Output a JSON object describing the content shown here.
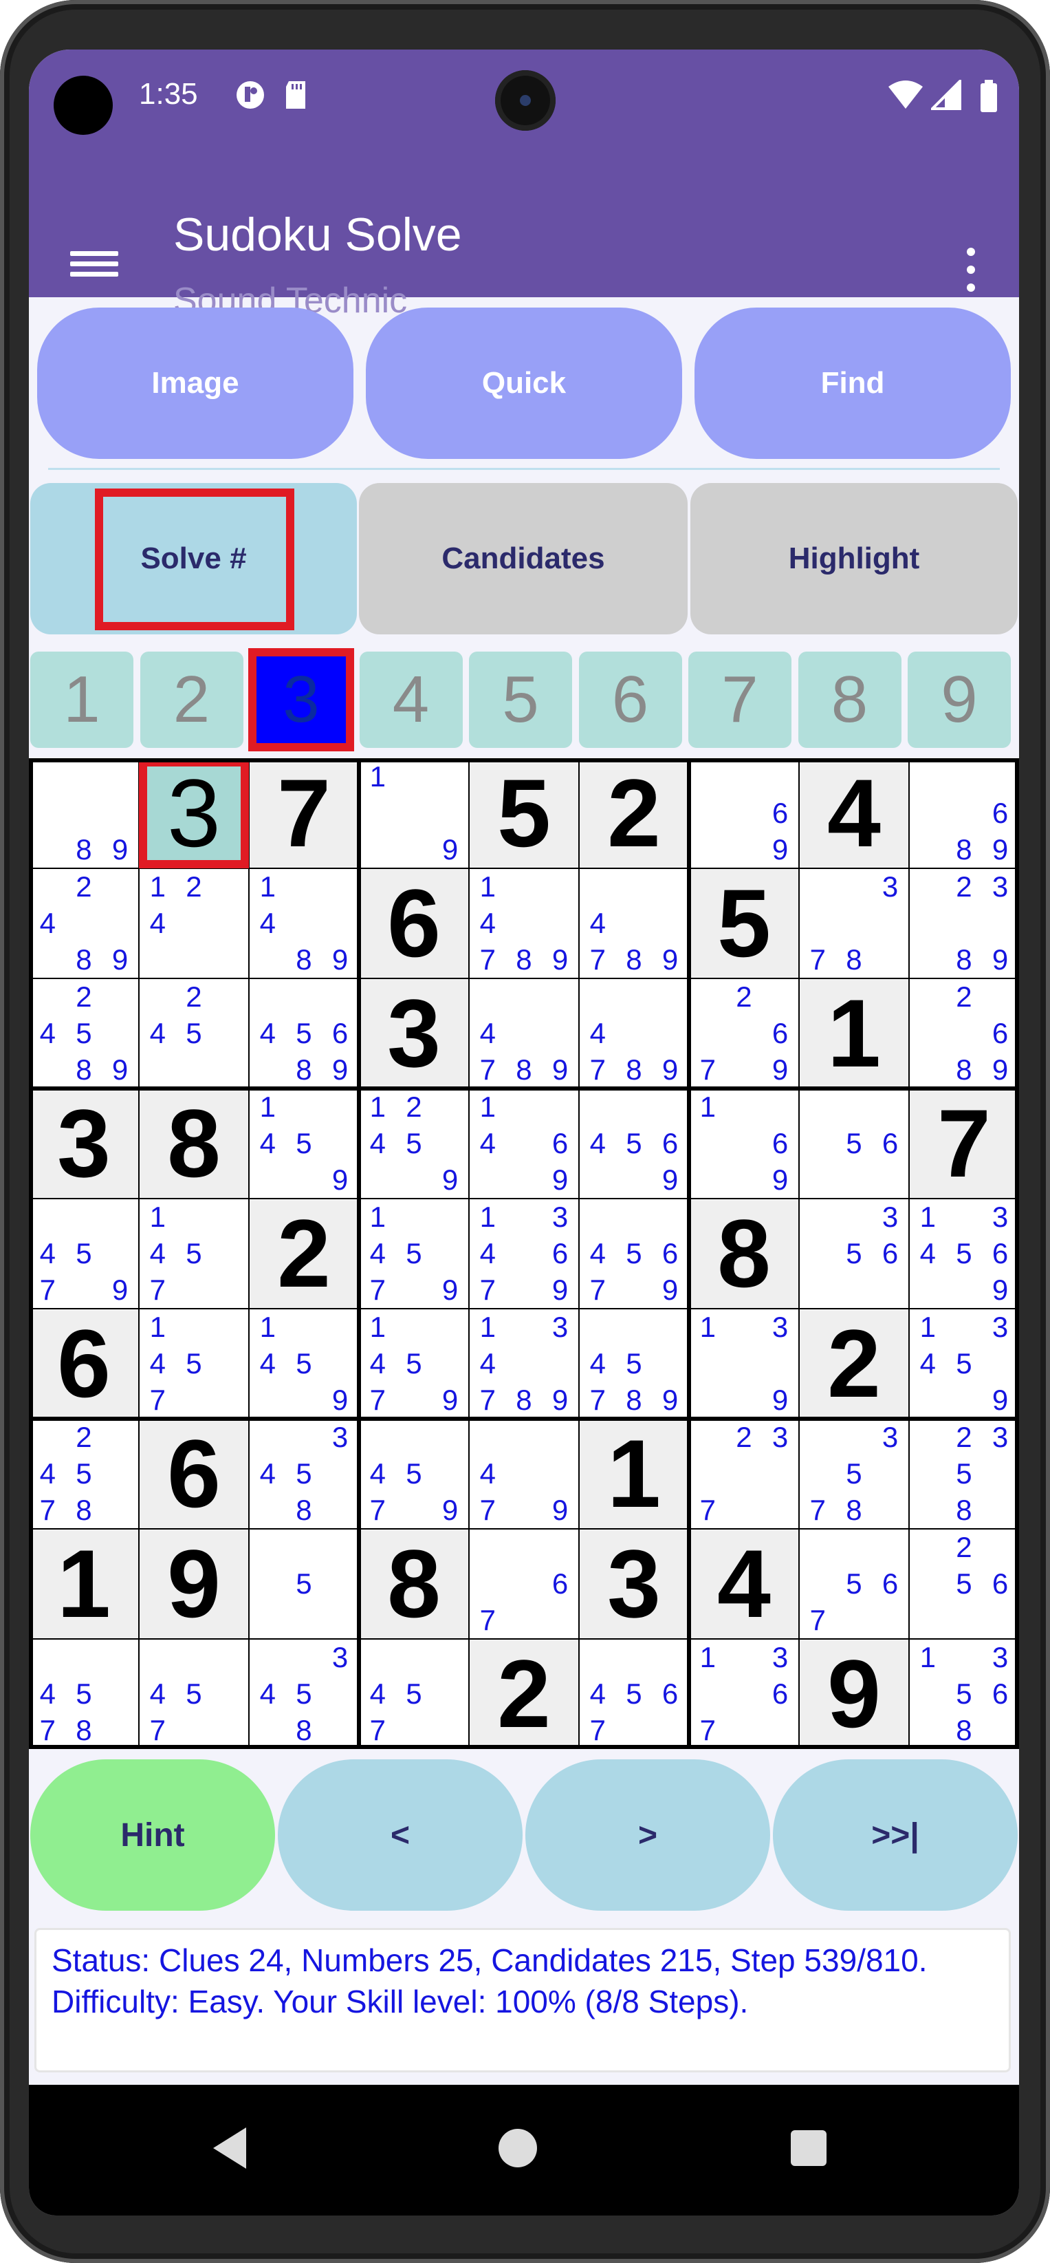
{
  "status_bar": {
    "time": "1:35"
  },
  "app_bar": {
    "title": "Sudoku Solve",
    "subtitle": "Sound Technic"
  },
  "top_buttons": [
    "Image",
    "Quick",
    "Find"
  ],
  "mode_buttons": [
    "Solve #",
    "Candidates",
    "Highlight"
  ],
  "number_selector": [
    "1",
    "2",
    "3",
    "4",
    "5",
    "6",
    "7",
    "8",
    "9"
  ],
  "selected_number": "3",
  "grid": [
    [
      {
        "c": [
          8,
          9
        ]
      },
      {
        "v": "3",
        "sel": true
      },
      {
        "v": "7",
        "given": true
      },
      {
        "c": [
          1,
          9
        ]
      },
      {
        "v": "5",
        "given": true
      },
      {
        "v": "2",
        "given": true
      },
      {
        "c": [
          6,
          9
        ]
      },
      {
        "v": "4",
        "given": true
      },
      {
        "c": [
          6,
          8,
          9
        ]
      }
    ],
    [
      {
        "c": [
          2,
          4,
          8,
          9
        ]
      },
      {
        "c": [
          1,
          2,
          4
        ]
      },
      {
        "c": [
          1,
          4,
          8,
          9
        ]
      },
      {
        "v": "6",
        "given": true
      },
      {
        "c": [
          1,
          4,
          7,
          8,
          9
        ]
      },
      {
        "c": [
          4,
          7,
          8,
          9
        ]
      },
      {
        "v": "5",
        "given": true
      },
      {
        "c": [
          3,
          7,
          8
        ]
      },
      {
        "c": [
          2,
          3,
          8,
          9
        ]
      }
    ],
    [
      {
        "c": [
          2,
          4,
          5,
          8,
          9
        ]
      },
      {
        "c": [
          2,
          4,
          5
        ]
      },
      {
        "c": [
          4,
          5,
          6,
          8,
          9
        ]
      },
      {
        "v": "3",
        "given": true
      },
      {
        "c": [
          4,
          7,
          8,
          9
        ]
      },
      {
        "c": [
          4,
          7,
          8,
          9
        ]
      },
      {
        "c": [
          2,
          6,
          7,
          9
        ]
      },
      {
        "v": "1",
        "given": true
      },
      {
        "c": [
          2,
          6,
          8,
          9
        ]
      }
    ],
    [
      {
        "v": "3",
        "given": true
      },
      {
        "v": "8",
        "given": true
      },
      {
        "c": [
          1,
          4,
          5,
          9
        ]
      },
      {
        "c": [
          1,
          2,
          4,
          5,
          9
        ]
      },
      {
        "c": [
          1,
          4,
          6,
          9
        ]
      },
      {
        "c": [
          4,
          5,
          6,
          9
        ]
      },
      {
        "c": [
          1,
          6,
          9
        ]
      },
      {
        "c": [
          5,
          6
        ]
      },
      {
        "v": "7",
        "given": true
      }
    ],
    [
      {
        "c": [
          4,
          5,
          7,
          9
        ]
      },
      {
        "c": [
          1,
          4,
          5,
          7
        ]
      },
      {
        "v": "2",
        "given": true
      },
      {
        "c": [
          1,
          4,
          5,
          7,
          9
        ]
      },
      {
        "c": [
          1,
          3,
          4,
          6,
          7,
          9
        ]
      },
      {
        "c": [
          4,
          5,
          6,
          7,
          9
        ]
      },
      {
        "v": "8",
        "given": true
      },
      {
        "c": [
          3,
          5,
          6
        ]
      },
      {
        "c": [
          1,
          3,
          4,
          5,
          6,
          9
        ]
      }
    ],
    [
      {
        "v": "6",
        "given": true
      },
      {
        "c": [
          1,
          4,
          5,
          7
        ]
      },
      {
        "c": [
          1,
          4,
          5,
          9
        ]
      },
      {
        "c": [
          1,
          4,
          5,
          7,
          9
        ]
      },
      {
        "c": [
          1,
          3,
          4,
          7,
          8,
          9
        ]
      },
      {
        "c": [
          4,
          5,
          7,
          8,
          9
        ]
      },
      {
        "c": [
          1,
          3,
          9
        ]
      },
      {
        "v": "2",
        "given": true
      },
      {
        "c": [
          1,
          3,
          4,
          5,
          9
        ]
      }
    ],
    [
      {
        "c": [
          2,
          4,
          5,
          7,
          8
        ]
      },
      {
        "v": "6",
        "given": true
      },
      {
        "c": [
          3,
          4,
          5,
          8
        ]
      },
      {
        "c": [
          4,
          5,
          7,
          9
        ]
      },
      {
        "c": [
          4,
          7,
          9
        ]
      },
      {
        "v": "1",
        "given": true
      },
      {
        "c": [
          2,
          3,
          7
        ]
      },
      {
        "c": [
          3,
          5,
          7,
          8
        ]
      },
      {
        "c": [
          2,
          3,
          5,
          8
        ]
      }
    ],
    [
      {
        "v": "1",
        "given": true
      },
      {
        "v": "9",
        "given": true
      },
      {
        "c": [
          5
        ]
      },
      {
        "v": "8",
        "given": true
      },
      {
        "c": [
          6,
          7
        ]
      },
      {
        "v": "3",
        "given": true
      },
      {
        "v": "4",
        "given": true
      },
      {
        "c": [
          5,
          6,
          7
        ]
      },
      {
        "c": [
          2,
          5,
          6
        ]
      }
    ],
    [
      {
        "c": [
          4,
          5,
          7,
          8
        ]
      },
      {
        "c": [
          4,
          5,
          7
        ]
      },
      {
        "c": [
          3,
          4,
          5,
          8
        ]
      },
      {
        "c": [
          4,
          5,
          7
        ]
      },
      {
        "v": "2",
        "given": true
      },
      {
        "c": [
          4,
          5,
          6,
          7
        ]
      },
      {
        "c": [
          1,
          3,
          6,
          7
        ]
      },
      {
        "v": "9",
        "given": true
      },
      {
        "c": [
          1,
          3,
          5,
          6,
          8
        ]
      }
    ]
  ],
  "controls": [
    "Hint",
    "<",
    ">",
    ">>|"
  ],
  "status_text": "Status: Clues 24, Numbers 25, Candidates 215, Step 539/810. Difficulty: Easy. Your Skill level: 100% (8/8 Steps).",
  "colors": {
    "primary": "#6750a4",
    "pill": "#98a0f7",
    "active_mode": "#add8e6",
    "idle_mode": "#cfcfcf",
    "hint": "#90ee90",
    "candidate": "#1515e0",
    "highlight_red": "#e01b24",
    "selected_number": "#0000ff"
  }
}
